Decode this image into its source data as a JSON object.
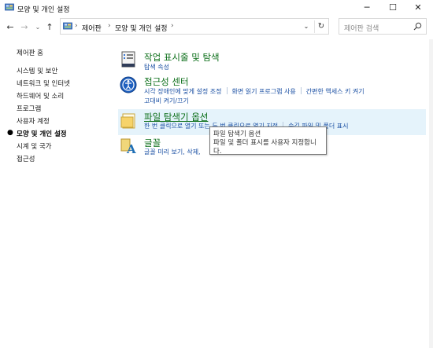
{
  "window": {
    "title": "모양 및 개인 설정",
    "buttons": {
      "minimize": "─",
      "maximize": "☐",
      "close": "✕"
    }
  },
  "nav": {
    "back": "←",
    "forward": "→",
    "recent": "⌄",
    "up": "↑",
    "breadcrumb": [
      "제어판",
      "모양 및 개인 설정"
    ],
    "sep": "›",
    "dropdown": "⌄",
    "refresh": "↻",
    "search_placeholder": "제어판 검색"
  },
  "sidebar": {
    "items": [
      {
        "label": "제어판 홈"
      },
      {
        "label": "시스템 및 보안"
      },
      {
        "label": "네트워크 및 인터넷"
      },
      {
        "label": "하드웨어 및 소리"
      },
      {
        "label": "프로그램"
      },
      {
        "label": "사용자 계정"
      },
      {
        "label": "모양 및 개인 설정"
      },
      {
        "label": "시계 및 국가"
      },
      {
        "label": "접근성"
      }
    ],
    "bullet": "●"
  },
  "categories": [
    {
      "title": "작업 표시줄 및 탐색",
      "icon": "taskbar-icon",
      "links": [
        "탐색 속성"
      ]
    },
    {
      "title": "접근성 센터",
      "icon": "ease-of-access-icon",
      "links": [
        "시각 장애인에 맞게 설정 조정",
        "화면 읽기 프로그램 사용",
        "간편한 액세스 키 켜기"
      ],
      "links2": [
        "고대비 켜기/끄기"
      ]
    },
    {
      "title": "파일 탐색기 옵션",
      "icon": "folder-options-icon",
      "links": [
        "한 번 클릭으로 열기 또는 두 번 클릭으로 열기 지정",
        "숨김 파일 및 폴더 표시"
      ]
    },
    {
      "title": "글꼴",
      "icon": "fonts-icon",
      "links": [
        "글꼴 미리 보기, 삭제,"
      ]
    }
  ],
  "tooltip": {
    "line1": "파일 탐색기 옵션",
    "line2": "파일 및 폴더 표시를 사용자 지정합니",
    "line3": "다."
  },
  "colors": {
    "title_green": "#0b6e18",
    "link_blue": "#1a4fa3",
    "hover": "#e5f3fb"
  }
}
